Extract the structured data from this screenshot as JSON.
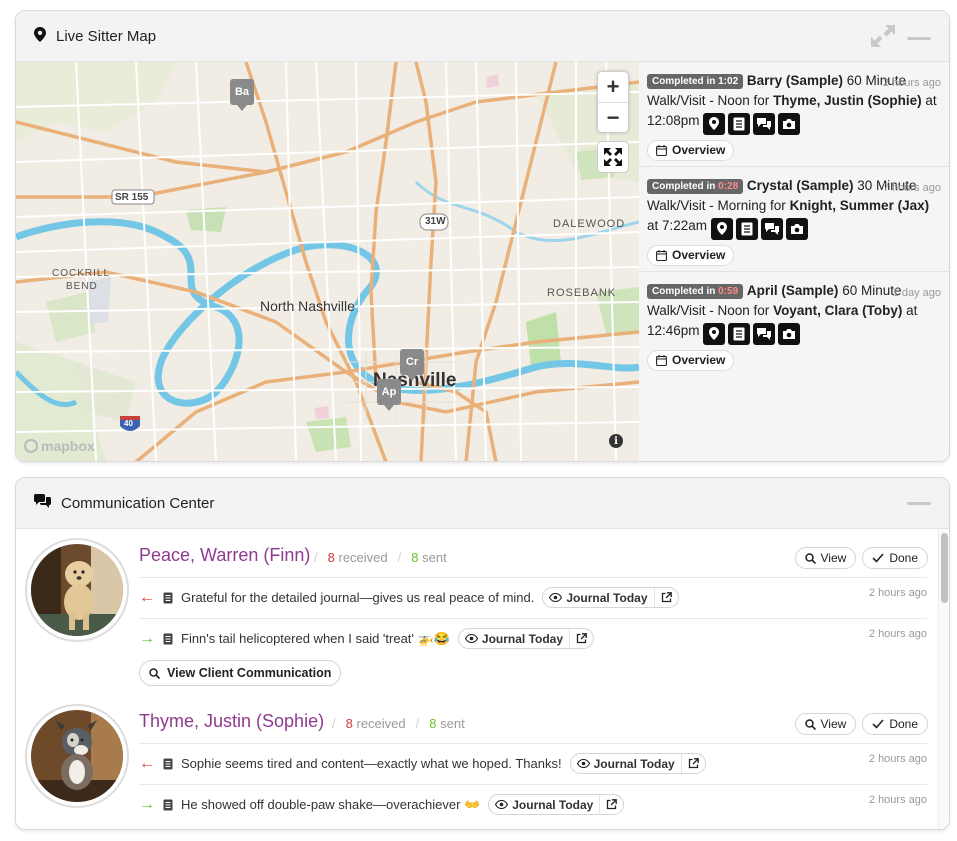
{
  "map_panel": {
    "title": "Live Sitter Map",
    "icons": {
      "header": "map-pin-icon",
      "expand": "expand-arrows-icon",
      "minimize": "minimize-icon"
    },
    "map": {
      "labels": {
        "north_nashville": "North Nashville",
        "nashville": "Nashville",
        "dalewood": "DALEWOOD",
        "rosebank": "ROSEBANK",
        "cockrill": "COCKRILL",
        "bend": "BEND",
        "sr155": "SR 155",
        "us31w": "31W",
        "i40": "40",
        "mapbox": "mapbox"
      },
      "markers": [
        "Ba",
        "Cr",
        "Ap"
      ],
      "zoom_in": "+",
      "zoom_out": "−",
      "info": "i"
    },
    "visits": [
      {
        "badge_prefix": "Completed in",
        "duration": "1:02",
        "sitter": "Barry (Sample)",
        "desc": "60 Minute Walk/Visit - Noon for",
        "client": "Thyme, Justin (Sophie)",
        "at": "at 12:08pm",
        "ago": "2 hours ago",
        "button": "Overview"
      },
      {
        "badge_prefix": "Completed in",
        "duration": "0:28",
        "sitter": "Crystal (Sample)",
        "desc": "30 Minute Walk/Visit - Morning for",
        "client": "Knight, Summer (Jax)",
        "at": "at 7:22am",
        "ago": "7 hours ago",
        "button": "Overview"
      },
      {
        "badge_prefix": "Completed in",
        "duration": "0:59",
        "sitter": "April (Sample)",
        "desc": "60 Minute Walk/Visit - Noon for",
        "client": "Voyant, Clara (Toby)",
        "at": "at 12:46pm",
        "ago": "1 day ago",
        "button": "Overview"
      }
    ],
    "visit_icons": [
      "location-icon",
      "journal-icon",
      "chat-icon",
      "camera-icon"
    ]
  },
  "comm_panel": {
    "title": "Communication Center",
    "icons": {
      "header": "comments-icon",
      "minimize": "minimize-icon"
    },
    "clients": [
      {
        "name": "Peace, Warren (Finn)",
        "received_count": "8",
        "received_label": "received",
        "sent_count": "8",
        "sent_label": "sent",
        "view": "View",
        "done": "Done",
        "messages": [
          {
            "direction": "incoming",
            "text": "Grateful for the detailed journal—gives us real peace of mind.",
            "button": "Journal Today",
            "ago": "2 hours ago"
          },
          {
            "direction": "outgoing",
            "text": "Finn's tail helicoptered when I said 'treat' 🚁😂",
            "button": "Journal Today",
            "ago": "2 hours ago"
          }
        ],
        "view_comm": "View Client Communication"
      },
      {
        "name": "Thyme, Justin (Sophie)",
        "received_count": "8",
        "received_label": "received",
        "sent_count": "8",
        "sent_label": "sent",
        "view": "View",
        "done": "Done",
        "messages": [
          {
            "direction": "incoming",
            "text": "Sophie seems tired and content—exactly what we hoped. Thanks!",
            "button": "Journal Today",
            "ago": "2 hours ago"
          },
          {
            "direction": "outgoing",
            "text": "He showed off double-paw shake—overachiever 👐",
            "button": "Journal Today",
            "ago": "2 hours ago"
          }
        ]
      }
    ]
  }
}
